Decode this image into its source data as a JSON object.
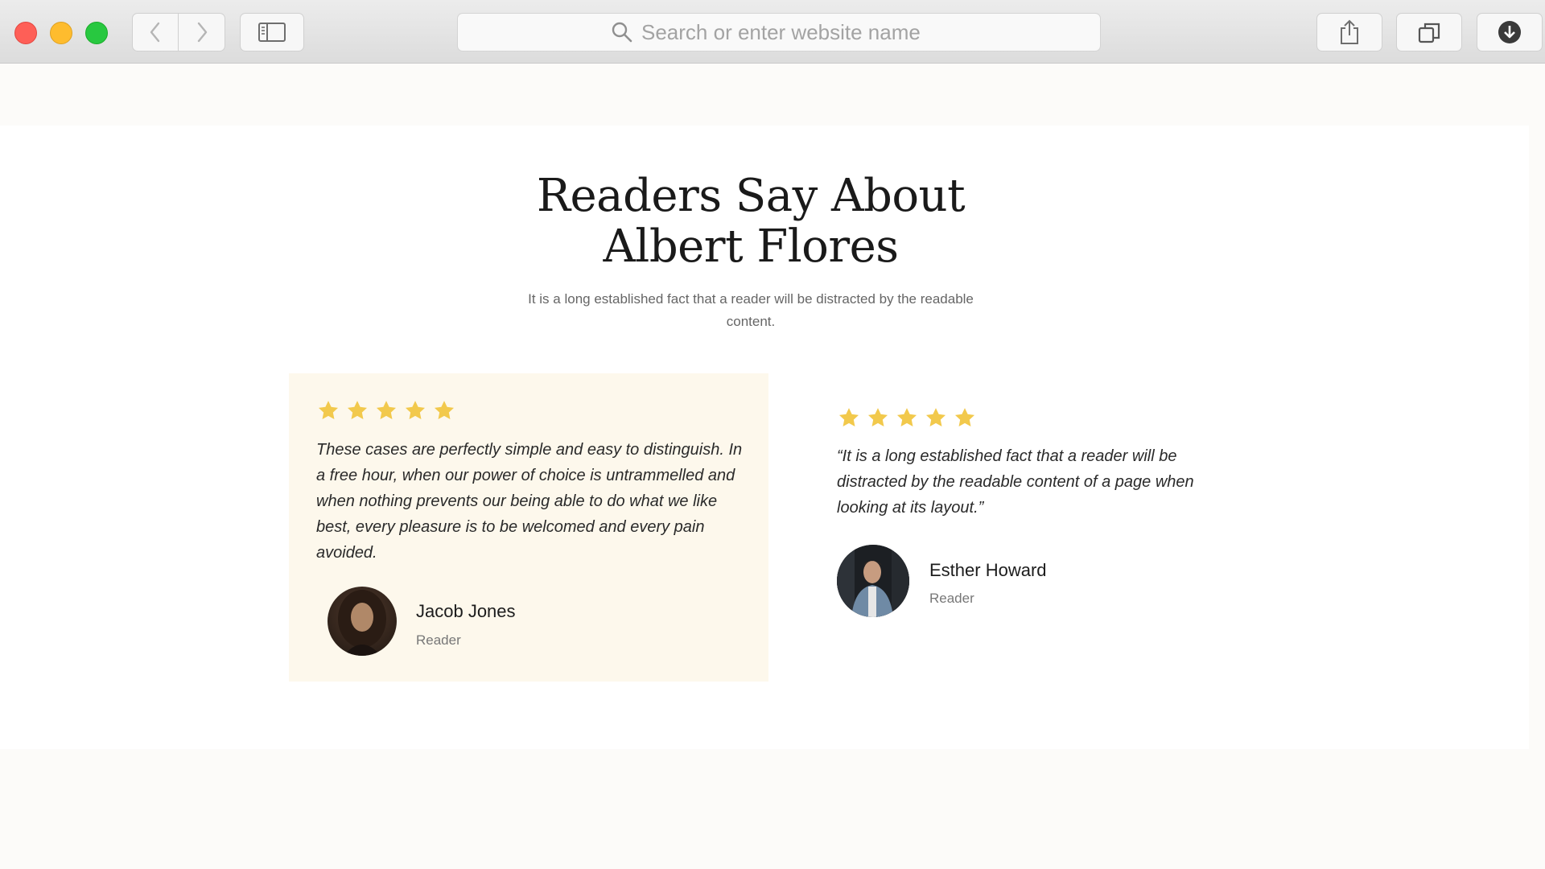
{
  "browser": {
    "search_placeholder": "Search or enter website name",
    "icons": {
      "back": "chevron-left-icon",
      "forward": "chevron-right-icon",
      "sidebar": "sidebar-icon",
      "search": "search-icon",
      "share": "share-icon",
      "tabs": "tabs-icon",
      "download": "download-icon"
    }
  },
  "section": {
    "title_line1": "Readers Say About",
    "title_line2": "Albert Flores",
    "subtitle": "It is a long established fact that a reader will be distracted by the readable content."
  },
  "colors": {
    "star": "#f2c94c",
    "featured_card_bg": "#fdf8ec"
  },
  "testimonials": [
    {
      "rating": 5,
      "quote": "These cases are perfectly simple and easy to distinguish. In a free hour, when our power of choice is untrammelled and when nothing prevents our being able to do what we like best, every pleasure is to be welcomed and every pain avoided.",
      "name": "Jacob Jones",
      "role": "Reader"
    },
    {
      "rating": 5,
      "quote": "“It is a long established fact that a reader will be distracted by the readable content of a page when looking at its layout.”",
      "name": "Esther Howard",
      "role": "Reader"
    }
  ]
}
